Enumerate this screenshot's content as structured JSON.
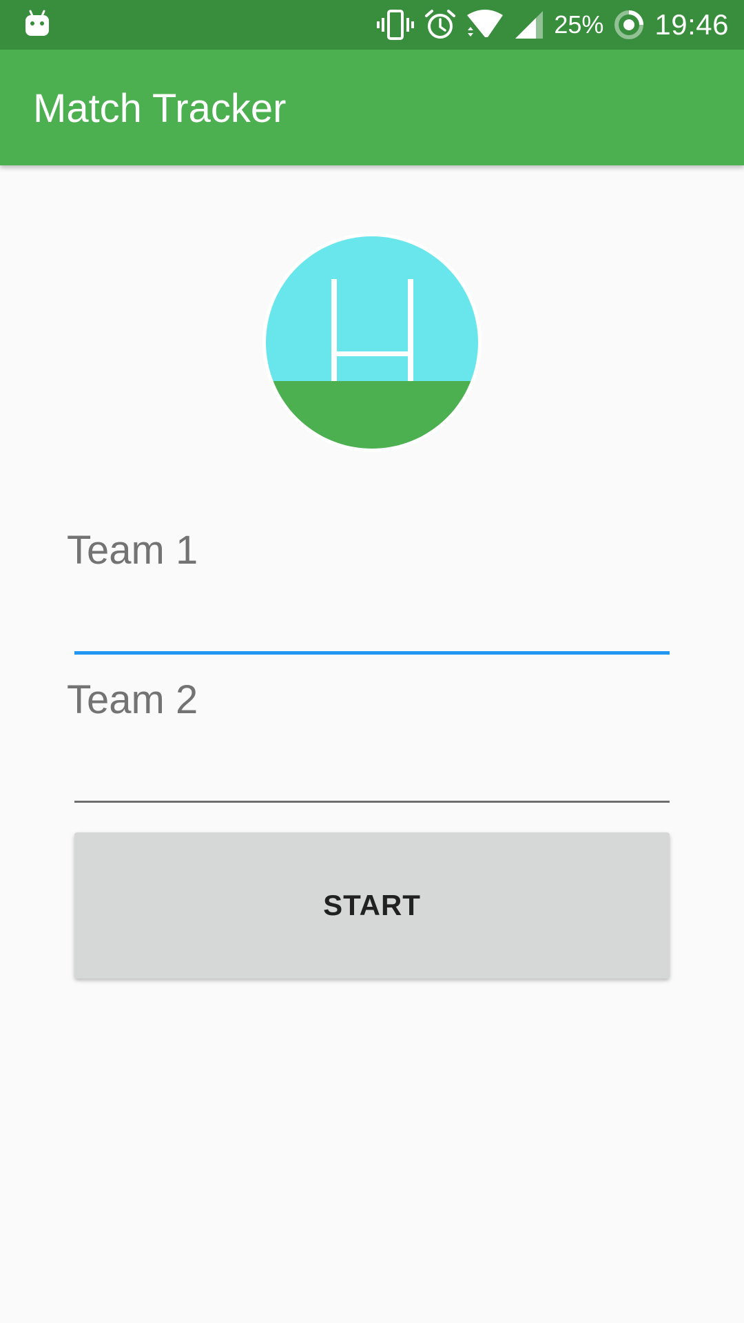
{
  "status_bar": {
    "battery_percent": "25%",
    "time": "19:46",
    "icons": [
      "android-debug-icon",
      "vibrate-icon",
      "alarm-icon",
      "wifi-icon",
      "cell-signal-icon",
      "battery-saver-icon"
    ]
  },
  "app_bar": {
    "title": "Match Tracker"
  },
  "logo": {
    "icon": "rugby-goalpost-logo"
  },
  "form": {
    "team1": {
      "label": "Team 1",
      "value": ""
    },
    "team2": {
      "label": "Team 2",
      "value": ""
    },
    "start_label": "START"
  },
  "colors": {
    "status_bar": "#388e3c",
    "app_bar": "#4caf50",
    "accent": "#2196f3",
    "sky": "#68e6ec",
    "grass": "#4caf50",
    "button": "#d6d7d7"
  }
}
